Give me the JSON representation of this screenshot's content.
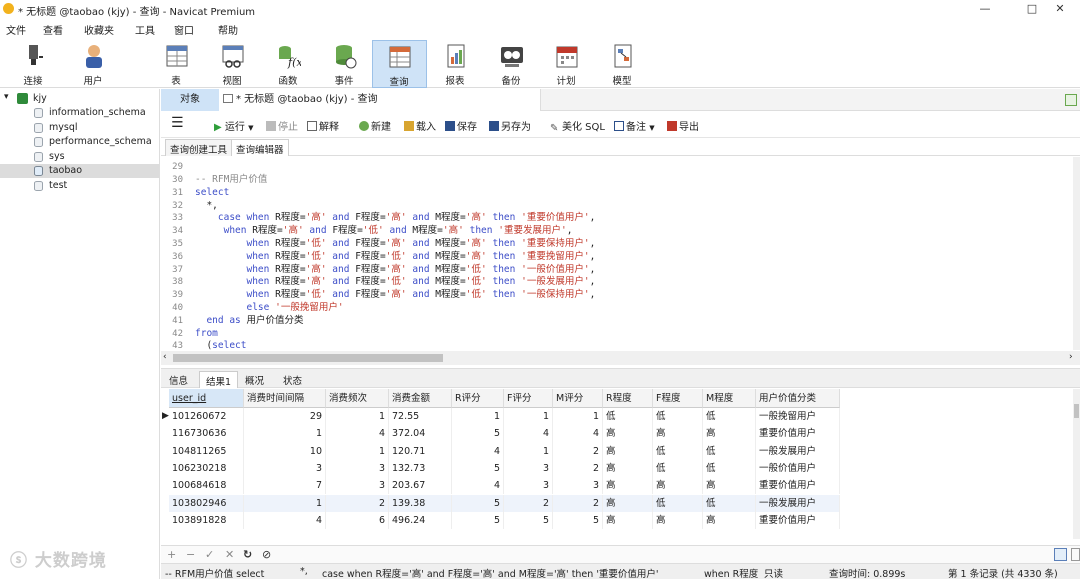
{
  "window": {
    "title": "* 无标题 @taobao (kjy) - 查询 - Navicat Premium",
    "min": "—",
    "max": "□",
    "close": "✕"
  },
  "menu": [
    "文件",
    "查看",
    "收藏夹",
    "工具",
    "窗口",
    "帮助"
  ],
  "toolbar": [
    "连接",
    "用户",
    "表",
    "视图",
    "函数",
    "事件",
    "查询",
    "报表",
    "备份",
    "计划",
    "模型"
  ],
  "tree": {
    "root": "kjy",
    "databases": [
      "information_schema",
      "mysql",
      "performance_schema",
      "sys",
      "taobao",
      "test"
    ],
    "selected": "taobao"
  },
  "tabs": {
    "objects": "对象",
    "query": "* 无标题 @taobao (kjy) - 查询"
  },
  "query_toolbar": {
    "run": "运行",
    "stop": "停止",
    "explain": "解释",
    "new": "新建",
    "load": "载入",
    "save": "保存",
    "save_as": "另存为",
    "beautify": "美化 SQL",
    "comment": "备注",
    "export": "导出"
  },
  "editor_tabs": [
    "查询创建工具",
    "查询编辑器"
  ],
  "code": {
    "line_numbers": [
      "29",
      "30",
      "31",
      "32",
      "33",
      "34",
      "35",
      "36",
      "37",
      "38",
      "39",
      "40",
      "41",
      "42",
      "43"
    ]
  },
  "result_tabs": [
    "信息",
    "结果1",
    "概况",
    "状态"
  ],
  "grid": {
    "columns": [
      "user_id",
      "消费时间间隔",
      "消费频次",
      "消费金额",
      "R评分",
      "F评分",
      "M评分",
      "R程度",
      "F程度",
      "M程度",
      "用户价值分类"
    ],
    "rows": [
      [
        "101260672",
        "29",
        "1",
        "72.55",
        "1",
        "1",
        "1",
        "低",
        "低",
        "低",
        "一般挽留用户"
      ],
      [
        "116730636",
        "1",
        "4",
        "372.04",
        "5",
        "4",
        "4",
        "高",
        "高",
        "高",
        "重要价值用户"
      ],
      [
        "104811265",
        "10",
        "1",
        "120.71",
        "4",
        "1",
        "2",
        "高",
        "低",
        "低",
        "一般发展用户"
      ],
      [
        "106230218",
        "3",
        "3",
        "132.73",
        "5",
        "3",
        "2",
        "高",
        "低",
        "低",
        "一般价值用户"
      ],
      [
        "100684618",
        "7",
        "3",
        "203.67",
        "4",
        "3",
        "3",
        "高",
        "高",
        "高",
        "重要价值用户"
      ],
      [
        "103802946",
        "1",
        "2",
        "139.38",
        "5",
        "2",
        "2",
        "高",
        "低",
        "低",
        "一般发展用户"
      ],
      [
        "103891828",
        "4",
        "6",
        "496.24",
        "5",
        "5",
        "5",
        "高",
        "高",
        "高",
        "重要价值用户"
      ]
    ]
  },
  "nav": [
    "+",
    "−",
    "✓",
    "✕",
    "↻",
    "⊘"
  ],
  "status": {
    "sql": "-- RFM用户价值 select",
    "sql2": "*,",
    "sql3": "case when R程度='高' and F程度='高' and M程度='高' then '重要价值用户'",
    "sql4": "when R程度",
    "readonly": "只读",
    "time": "查询时间: 0.899s",
    "records": "第 1 条记录 (共 4330 条)"
  },
  "watermark": "大数跨境"
}
